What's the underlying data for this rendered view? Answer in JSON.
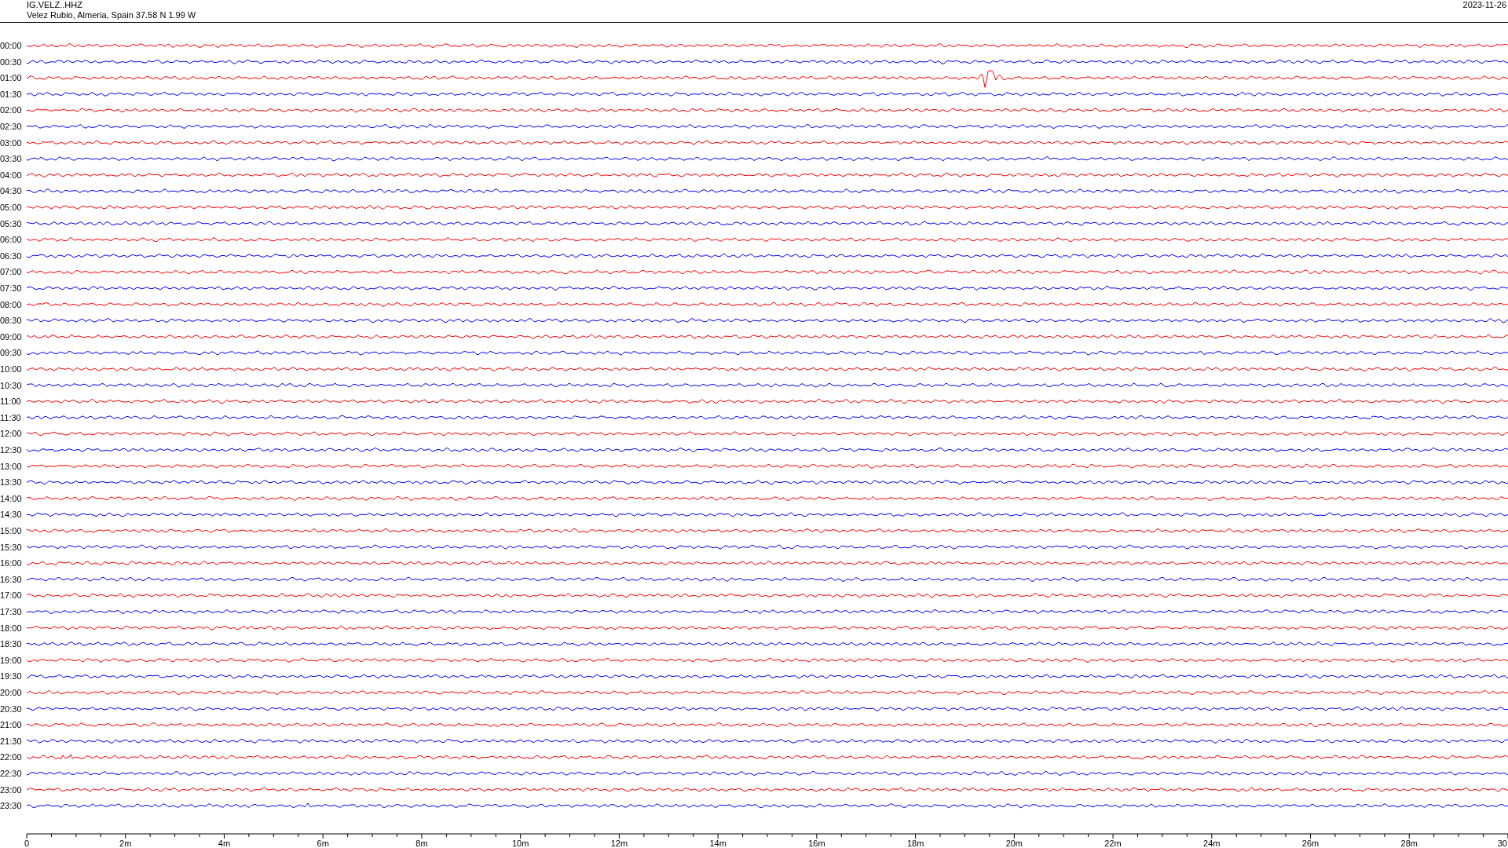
{
  "header": {
    "station": "IG.VELZ..HHZ",
    "location": "Velez Rubio, Almeria, Spain  37.58 N 1.99 W",
    "date": "2023-11-26"
  },
  "traces": [
    {
      "time": "00:00",
      "color": "#ff0000"
    },
    {
      "time": "00:30",
      "color": "#0000ff"
    },
    {
      "time": "01:00",
      "color": "#ff0000"
    },
    {
      "time": "01:30",
      "color": "#0000ff"
    },
    {
      "time": "02:00",
      "color": "#ff0000"
    },
    {
      "time": "02:30",
      "color": "#0000ff"
    },
    {
      "time": "03:00",
      "color": "#ff0000"
    },
    {
      "time": "03:30",
      "color": "#0000ff"
    },
    {
      "time": "04:00",
      "color": "#ff0000"
    },
    {
      "time": "04:30",
      "color": "#0000ff"
    },
    {
      "time": "05:00",
      "color": "#ff0000"
    },
    {
      "time": "05:30",
      "color": "#0000ff"
    },
    {
      "time": "06:00",
      "color": "#ff0000"
    },
    {
      "time": "06:30",
      "color": "#0000ff"
    },
    {
      "time": "07:00",
      "color": "#ff0000"
    },
    {
      "time": "07:30",
      "color": "#0000ff"
    },
    {
      "time": "08:00",
      "color": "#ff0000"
    },
    {
      "time": "08:30",
      "color": "#0000ff"
    },
    {
      "time": "09:00",
      "color": "#ff0000"
    },
    {
      "time": "09:30",
      "color": "#0000ff"
    },
    {
      "time": "10:00",
      "color": "#ff0000"
    },
    {
      "time": "10:30",
      "color": "#0000ff"
    },
    {
      "time": "11:00",
      "color": "#ff0000"
    },
    {
      "time": "11:30",
      "color": "#0000ff"
    },
    {
      "time": "12:00",
      "color": "#ff0000"
    },
    {
      "time": "12:30",
      "color": "#0000ff"
    },
    {
      "time": "13:00",
      "color": "#ff0000"
    },
    {
      "time": "13:30",
      "color": "#0000ff"
    },
    {
      "time": "14:00",
      "color": "#ff0000"
    },
    {
      "time": "14:30",
      "color": "#0000ff"
    },
    {
      "time": "15:00",
      "color": "#ff0000"
    },
    {
      "time": "15:30",
      "color": "#0000ff"
    },
    {
      "time": "16:00",
      "color": "#ff0000"
    },
    {
      "time": "16:30",
      "color": "#0000ff"
    },
    {
      "time": "17:00",
      "color": "#ff0000"
    },
    {
      "time": "17:30",
      "color": "#0000ff"
    },
    {
      "time": "18:00",
      "color": "#ff0000"
    },
    {
      "time": "18:30",
      "color": "#0000ff"
    },
    {
      "time": "19:00",
      "color": "#ff0000"
    },
    {
      "time": "19:30",
      "color": "#0000ff"
    },
    {
      "time": "20:00",
      "color": "#ff0000"
    },
    {
      "time": "20:30",
      "color": "#0000ff"
    },
    {
      "time": "21:00",
      "color": "#ff0000"
    },
    {
      "time": "21:30",
      "color": "#0000ff"
    },
    {
      "time": "22:00",
      "color": "#ff0000"
    },
    {
      "time": "22:30",
      "color": "#0000ff"
    },
    {
      "time": "23:00",
      "color": "#ff0000"
    },
    {
      "time": "23:30",
      "color": "#0000ff"
    }
  ],
  "x_axis_labels": [
    "0",
    "2m",
    "4m",
    "6m",
    "8m",
    "10m",
    "12m",
    "14m",
    "16m",
    "18m",
    "20m",
    "22m",
    "24m",
    "26m",
    "28m",
    "30"
  ]
}
